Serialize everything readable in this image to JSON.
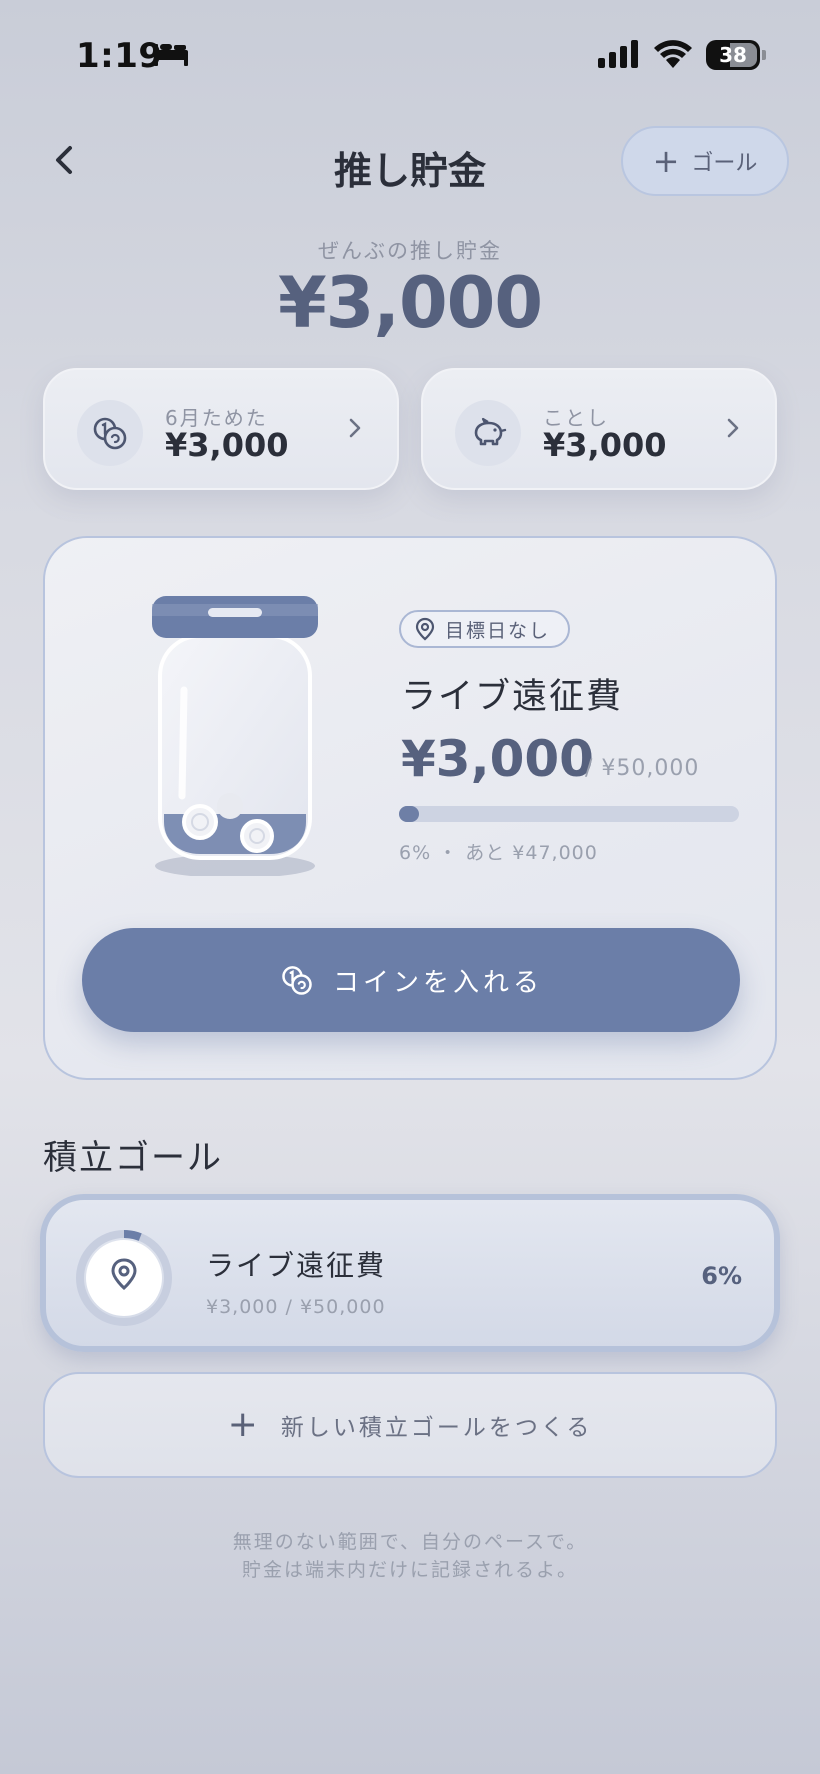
{
  "status_bar": {
    "time": "1:19",
    "battery": "38"
  },
  "header": {
    "title": "推し貯金",
    "add_goal_label": "ゴール"
  },
  "total": {
    "label": "ぜんぶの推し貯金",
    "amount": "¥3,000"
  },
  "summary": [
    {
      "label": "6月ためた",
      "value": "¥3,000",
      "icon": "coins-icon"
    },
    {
      "label": "ことし",
      "value": "¥3,000",
      "icon": "piggy-bank-icon"
    }
  ],
  "goal_card": {
    "deadline": "目標日なし",
    "title": "ライブ遠征費",
    "amount": "¥3,000",
    "target": "/ ¥50,000",
    "progress": 0.06,
    "progress_text": "6% ・ あと ¥47,000",
    "button_label": "コインを入れる"
  },
  "goals_section": {
    "title": "積立ゴール",
    "items": [
      {
        "title": "ライブ遠征費",
        "amount": "¥3,000 / ¥50,000",
        "percent": "6%",
        "progress": 0.06
      }
    ],
    "new_goal_label": "新しい積立ゴールをつくる"
  },
  "footer": {
    "line1": "無理のない範囲で、自分のペースで。",
    "line2": "貯金は端末内だけに記録されるよ。"
  },
  "colors": {
    "accent": "#6b7ea8",
    "amount_text": "#56617e",
    "border_accent": "#b8c4de"
  }
}
